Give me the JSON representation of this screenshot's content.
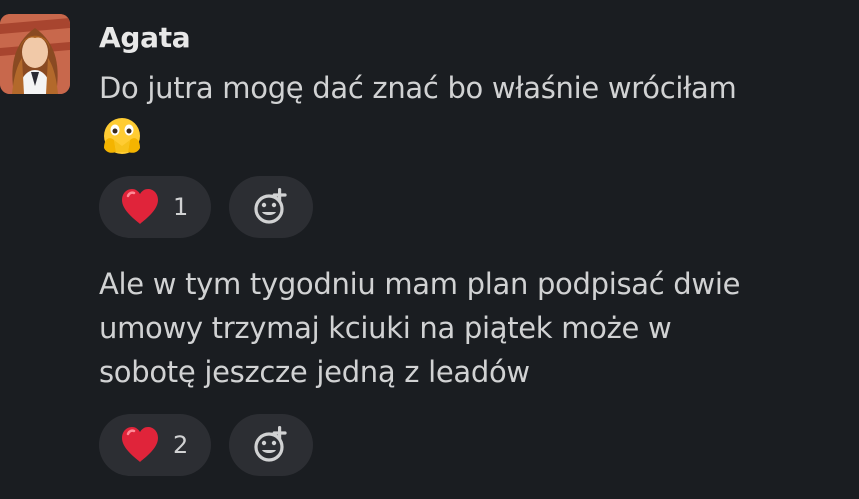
{
  "author": {
    "name": "Agata",
    "avatar_icon": "user-avatar-photo"
  },
  "messages": [
    {
      "lines": [
        "Do jutra mogę dać znać bo właśnie wróciłam"
      ],
      "trailing_emoji": "face-with-open-eyes-and-hand-over-mouth",
      "reactions": [
        {
          "emoji": "red-heart",
          "count": "1"
        }
      ],
      "add_reaction_icon": "add-reaction-icon"
    },
    {
      "lines": [
        "Ale w tym tygodniu mam plan podpisać dwie",
        "umowy trzymaj kciuki na piątek może w",
        "sobotę jeszcze jedną z leadów"
      ],
      "reactions": [
        {
          "emoji": "red-heart",
          "count": "2"
        }
      ],
      "add_reaction_icon": "add-reaction-icon"
    }
  ],
  "colors": {
    "background": "#1a1d21",
    "text": "#d1d2d3",
    "pill": "#2c2e33",
    "heart": "#e0243a"
  }
}
